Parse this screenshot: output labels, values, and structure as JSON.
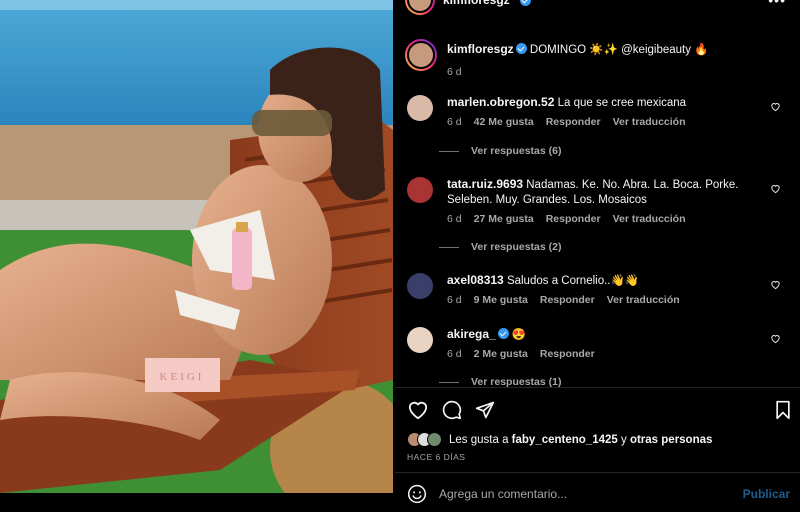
{
  "post": {
    "username": "kimfloresgz",
    "caption_text": "DOMINGO ☀️✨ @keigibeauty 🔥",
    "caption_age": "6 d",
    "photo_label": "KEIGI"
  },
  "comments": [
    {
      "user": "marlen.obregon.52",
      "text": "La que se cree mexicana",
      "age": "6 d",
      "likes": "42 Me gusta",
      "reply": "Responder",
      "translate": "Ver traducción",
      "replies": "Ver respuestas (6)",
      "verified": false
    },
    {
      "user": "tata.ruiz.9693",
      "text": "Nadamas. Ke. No. Abra. La. Boca. Porke. Seleben. Muy. Grandes. Los. Mosaicos",
      "age": "6 d",
      "likes": "27 Me gusta",
      "reply": "Responder",
      "translate": "Ver traducción",
      "replies": "Ver respuestas (2)",
      "verified": false
    },
    {
      "user": "axel08313",
      "text": "Saludos a Cornelio..👋👋",
      "age": "6 d",
      "likes": "9 Me gusta",
      "reply": "Responder",
      "translate": "Ver traducción",
      "replies": "",
      "verified": false
    },
    {
      "user": "akirega_",
      "text": "😍",
      "age": "6 d",
      "likes": "2 Me gusta",
      "reply": "Responder",
      "translate": "",
      "replies": "Ver respuestas (1)",
      "verified": true
    }
  ],
  "likes": {
    "prefix": "Les gusta a",
    "user": "faby_centeno_1425",
    "middle": "y",
    "suffix": "otras personas"
  },
  "date": "HACE 6 DÍAS",
  "composer": {
    "placeholder": "Agrega un comentario...",
    "post_label": "Publicar"
  },
  "icons": [
    "heart-icon",
    "comment-icon",
    "share-icon",
    "bookmark-icon",
    "emoji-icon",
    "more-icon",
    "verified-badge-icon"
  ],
  "colors": {
    "accent": "#3897f0",
    "post_button": "#1f5d8f",
    "muted": "#a8a8a8",
    "background": "#000000"
  }
}
